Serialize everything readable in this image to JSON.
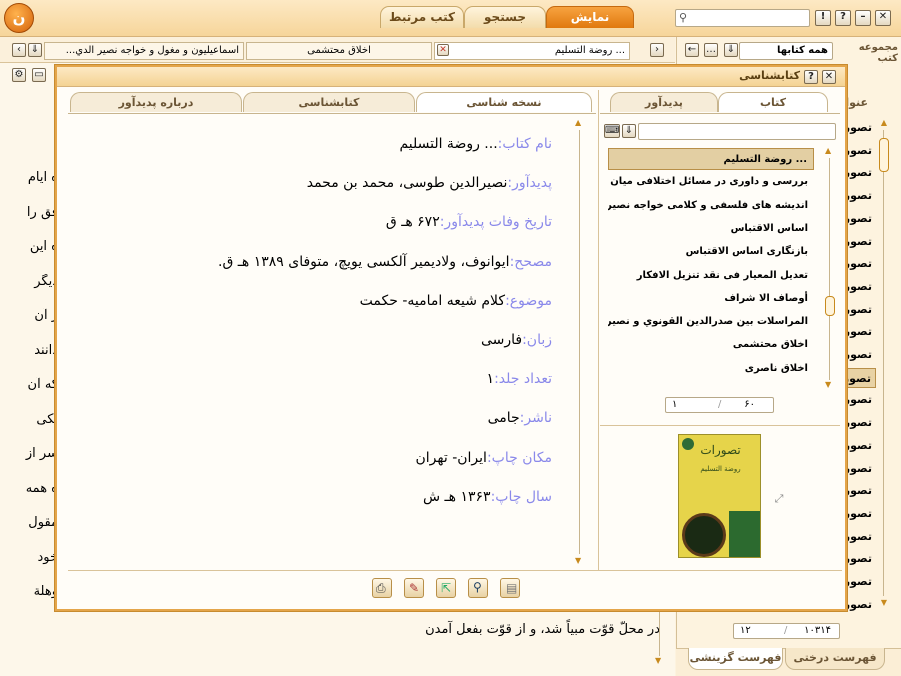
{
  "app": {
    "tabs": [
      "نمایش",
      "جستجو",
      "کتب مرتبط"
    ],
    "win_icons": [
      "close-icon",
      "minimize-icon",
      "help-icon",
      "info-icon"
    ],
    "accent": "#e07a12"
  },
  "doc_tabs": [
    {
      "label": "... روضة التسليم",
      "active": true
    },
    {
      "label": "اخلاق محتشمی",
      "active": false
    },
    {
      "label": "اسماعیلیون و مغول و خواجه نصیر الدي...",
      "active": false
    }
  ],
  "right_panel": {
    "collection_label": "مجموعه کتب",
    "collection_value": "همه کتابها",
    "column_header": "عنوا",
    "items": [
      "تصور",
      "تصور",
      "تصور",
      "تصور",
      "تصور",
      "تصور",
      "تصور",
      "تصور",
      "تصور",
      "تصور",
      "تصور",
      "تصور",
      "تصور",
      "تصور",
      "تصور",
      "تصور",
      "تصور",
      "تصور",
      "تصور",
      "تصور",
      "تصور",
      "تصور"
    ],
    "selected_index": 11,
    "pager": {
      "total": "۱۰۳۱۴",
      "current": "۱۲"
    },
    "bottom_tabs": [
      "فهرست درختی",
      "فهرست گزینشی"
    ]
  },
  "background_text": {
    "lines": [
      "ه ایام",
      "فق را",
      "ه این",
      "دیگر",
      "ر آن",
      "دانند",
      "که آن",
      "یکی",
      "سر از",
      "ه همه",
      "مقول",
      "خود",
      "وهلة"
    ],
    "bottom_line": "در محلّ قوّت مبیاً شد، و از قوّت بفعل آمدن"
  },
  "dialog": {
    "title": "کتابشناسی",
    "left_tabs": [
      "کتاب",
      "پدیدآور"
    ],
    "book_list": [
      "... روضة التسليم",
      "بررسی و داوری در مسائل اختلافی میان د ...",
      "اندیشه های فلسفی و کلامی خواجه نصیر ا ...",
      "اساس الاقتباس",
      "بازنگاری اساس الاقتباس",
      "تعديل المعيار فى نقد تنزيل الافكار",
      "أوصاف الا شراف",
      "المراسلات بين صدرالدين القونوي و نصیر ...",
      "اخلاق محتشمی",
      "اخلاق ناصری"
    ],
    "selected_book": 0,
    "list_pager": {
      "total": "۶۰",
      "current": "۱"
    },
    "cover": {
      "title": "تصورات",
      "subtitle": "روضة التسليم"
    },
    "right_tabs": [
      "نسخه شناسی",
      "کتابشناسی",
      "درباره پدیدآور"
    ],
    "fields": [
      {
        "label": "نام کتاب:",
        "value": "... روضة التسليم"
      },
      {
        "label": "پدیدآور:",
        "value": "نصیرالدین طوسی، محمد بن محمد"
      },
      {
        "label": "تاریخ وفات پدیدآور:",
        "value": "۶۷۲ هـ ق"
      },
      {
        "label": "مصحح:",
        "value": "ایوانوف، ولادیمیر آلکسی یویچ، متوفای ۱۳۸۹ هـ ق."
      },
      {
        "label": "موضوع:",
        "value": "کلام شیعه امامیه- حکمت"
      },
      {
        "label": "زبان:",
        "value": "فارسی"
      },
      {
        "label": "تعداد جلد:",
        "value": "۱"
      },
      {
        "label": "ناشر:",
        "value": "جامی"
      },
      {
        "label": "مکان چاپ:",
        "value": "ایران- تهران"
      },
      {
        "label": "سال چاپ:",
        "value": "۱۳۶۳ هـ ش"
      }
    ],
    "toolbar_icons": [
      "print-icon",
      "edit-icon",
      "export-icon",
      "search-icon",
      "notes-icon"
    ]
  }
}
